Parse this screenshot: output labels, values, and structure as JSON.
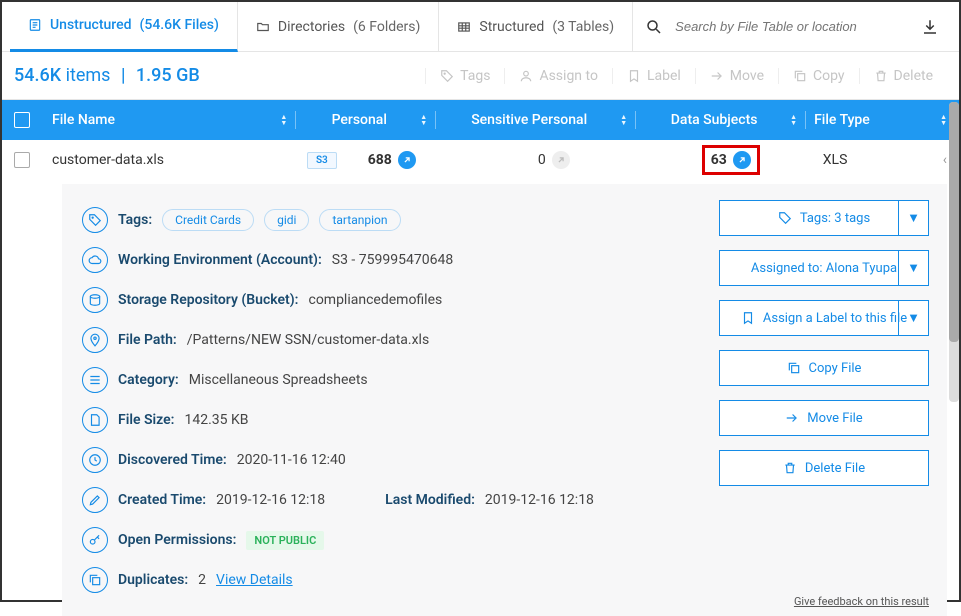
{
  "tabs": {
    "unstructured": {
      "label": "Unstructured",
      "paren": "(54.6K Files)"
    },
    "directories": {
      "label": "Directories",
      "paren": "(6 Folders)"
    },
    "structured": {
      "label": "Structured",
      "paren": "(3 Tables)"
    }
  },
  "search": {
    "placeholder": "Search by File Table or location"
  },
  "stats": {
    "count": "54.6K",
    "items_label": "items",
    "size": "1.95 GB"
  },
  "toolbar": {
    "tags": "Tags",
    "assign": "Assign to",
    "label": "Label",
    "move": "Move",
    "copy": "Copy",
    "delete": "Delete"
  },
  "columns": {
    "name": "File Name",
    "personal": "Personal",
    "sensitive": "Sensitive Personal",
    "subjects": "Data Subjects",
    "filetype": "File Type"
  },
  "row": {
    "filename": "customer-data.xls",
    "source": "S3",
    "personal": "688",
    "sensitive": "0",
    "subjects": "63",
    "filetype": "XLS"
  },
  "details": {
    "tags_label": "Tags:",
    "tags": [
      "Credit Cards",
      "gidi",
      "tartanpion"
    ],
    "env_label": "Working Environment (Account):",
    "env_value": "S3 - 759995470648",
    "repo_label": "Storage Repository (Bucket):",
    "repo_value": "compliancedemofiles",
    "path_label": "File Path:",
    "path_value": "/Patterns/NEW SSN/customer-data.xls",
    "cat_label": "Category:",
    "cat_value": "Miscellaneous Spreadsheets",
    "size_label": "File Size:",
    "size_value": "142.35 KB",
    "disc_label": "Discovered Time:",
    "disc_value": "2020-11-16 12:40",
    "created_label": "Created Time:",
    "created_value": "2019-12-16 12:18",
    "mod_label": "Last Modified:",
    "mod_value": "2019-12-16 12:18",
    "perm_label": "Open Permissions:",
    "perm_value": "NOT PUBLIC",
    "dup_label": "Duplicates:",
    "dup_count": "2",
    "dup_link": "View Details"
  },
  "side": {
    "tags_btn": "Tags: 3 tags",
    "assigned_btn": "Assigned to: Alona Tyupa",
    "label_btn": "Assign a Label to this file",
    "copy_btn": "Copy File",
    "move_btn": "Move File",
    "delete_btn": "Delete File"
  },
  "feedback": "Give feedback on this result"
}
